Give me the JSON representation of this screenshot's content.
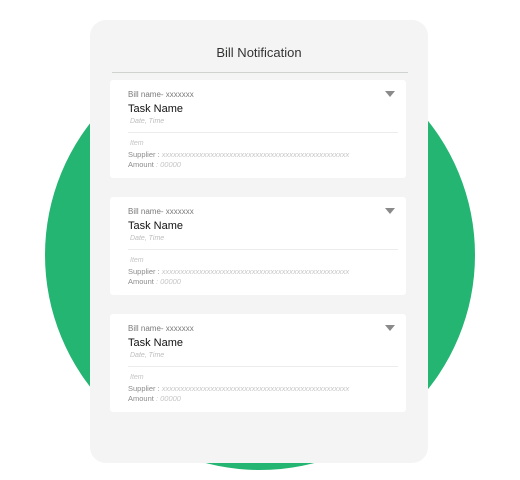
{
  "panel": {
    "title": "Bill Notification"
  },
  "bills": [
    {
      "bill_name": "Bill name- xxxxxxx",
      "task_name": "Task Name",
      "date_time": "Date, Time",
      "item": "Item",
      "supplier_label": "Supplier :",
      "supplier_value": "xxxxxxxxxxxxxxxxxxxxxxxxxxxxxxxxxxxxxxxxxxxxxxxxxx",
      "amount_label": "Amount",
      "amount_value": ": 00000"
    },
    {
      "bill_name": "Bill name- xxxxxxx",
      "task_name": "Task Name",
      "date_time": "Date, Time",
      "item": "Item",
      "supplier_label": "Supplier :",
      "supplier_value": "xxxxxxxxxxxxxxxxxxxxxxxxxxxxxxxxxxxxxxxxxxxxxxxxxx",
      "amount_label": "Amount",
      "amount_value": ": 00000"
    },
    {
      "bill_name": "Bill name- xxxxxxx",
      "task_name": "Task Name",
      "date_time": "Date, Time",
      "item": "Item",
      "supplier_label": "Supplier :",
      "supplier_value": "xxxxxxxxxxxxxxxxxxxxxxxxxxxxxxxxxxxxxxxxxxxxxxxxxx",
      "amount_label": "Amount",
      "amount_value": ": 00000"
    }
  ],
  "icons": {
    "dropdown": "chevron-down-icon",
    "background": "green-circle"
  },
  "colors": {
    "accent": "#24b572",
    "panel": "#f3f4f3",
    "card": "#ffffff",
    "arrow": "#8a8a8a"
  }
}
